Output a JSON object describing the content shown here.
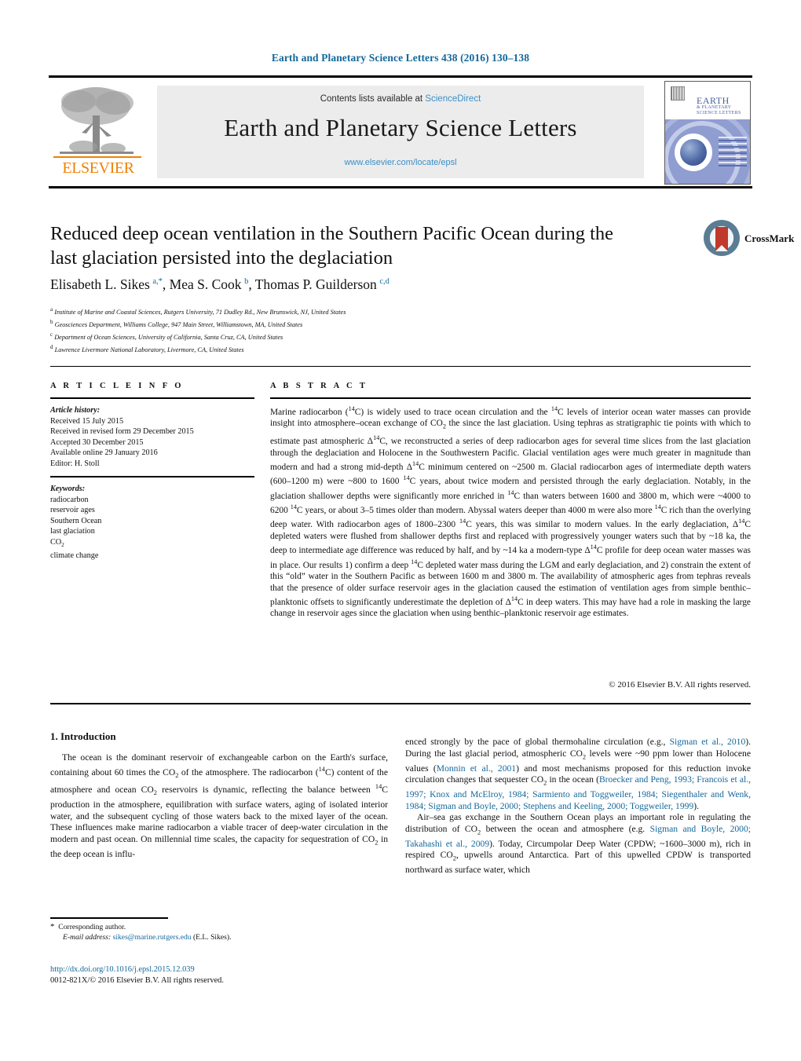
{
  "running_head": "Earth and Planetary Science Letters 438 (2016) 130–138",
  "masthead": {
    "contents_prefix": "Contents lists available at ",
    "sciencedirect": "ScienceDirect",
    "journal_title": "Earth and Planetary Science Letters",
    "journal_url": "www.elsevier.com/locate/epsl",
    "publisher": "ELSEVIER",
    "cover_title_line1": "EARTH",
    "cover_title_line2": "& PLANETARY SCIENCE LETTERS"
  },
  "crossmark": {
    "label": "CrossMark"
  },
  "article": {
    "title": "Reduced deep ocean ventilation in the Southern Pacific Ocean during the last glaciation persisted into the deglaciation",
    "affiliations": [
      {
        "marker": "a",
        "text": "Institute of Marine and Coastal Sciences, Rutgers University, 71 Dudley Rd., New Brunswick, NJ, United States"
      },
      {
        "marker": "b",
        "text": "Geosciences Department, Williams College, 947 Main Street, Williamstown, MA, United States"
      },
      {
        "marker": "c",
        "text": "Department of Ocean Sciences, University of California, Santa Cruz, CA, United States"
      },
      {
        "marker": "d",
        "text": "Lawrence Livermore National Laboratory, Livermore, CA, United States"
      }
    ]
  },
  "article_info": {
    "heading": "A R T I C L E  I N F O",
    "history_label": "Article history:",
    "history": [
      "Received 15 July 2015",
      "Received in revised form 29 December 2015",
      "Accepted 30 December 2015",
      "Available online 29 January 2016",
      "Editor: H. Stoll"
    ],
    "keywords_label": "Keywords:",
    "keywords": [
      "radiocarbon",
      "reservoir ages",
      "Southern Ocean",
      "last glaciation",
      "CO2",
      "climate change"
    ]
  },
  "abstract": {
    "heading": "A B S T R A C T",
    "copyright": "© 2016 Elsevier B.V. All rights reserved."
  },
  "body": {
    "section1_heading": "1. Introduction"
  },
  "footnote": {
    "corresponding": "Corresponding author.",
    "email_label": "E-mail address:",
    "email": "sikes@marine.rutgers.edu",
    "email_owner": "(E.L. Sikes)."
  },
  "doi": {
    "url": "http://dx.doi.org/10.1016/j.epsl.2015.12.039",
    "issn_line": "0012-821X/© 2016 Elsevier B.V. All rights reserved."
  },
  "colors": {
    "link": "#14679a",
    "sciencedirect": "#3b8fc7",
    "elsevier_orange": "#f08000",
    "crossmark_red": "#c0392b"
  }
}
